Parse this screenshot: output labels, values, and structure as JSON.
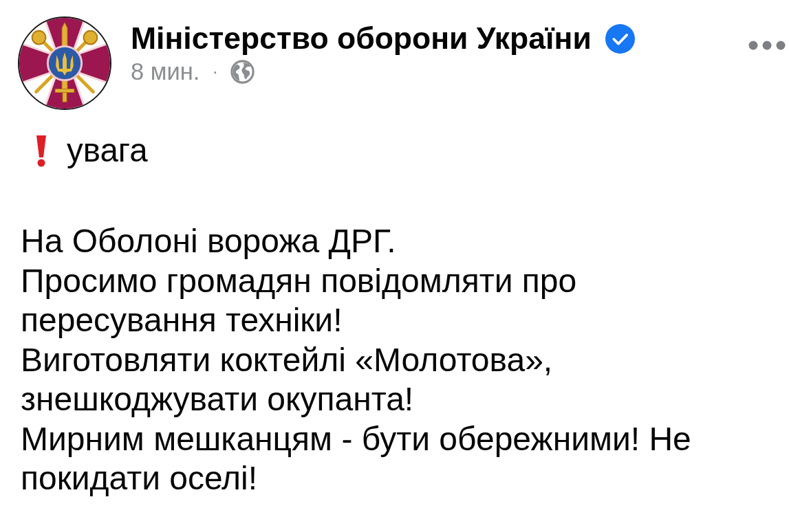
{
  "post": {
    "author": "Міністерство оборони України",
    "verified": true,
    "time": "8 мин.",
    "separator": "·"
  },
  "body": {
    "alert": "увага",
    "paragraphs": [
      "На Оболоні ворожа ДРГ.",
      "Просимо громадян повідомляти про пересування техніки!",
      "Виготовляти коктейлі «Молотова», знешкоджувати окупанта!",
      "Мирним мешканцям - бути обережними! Не покидати оселі!"
    ]
  }
}
